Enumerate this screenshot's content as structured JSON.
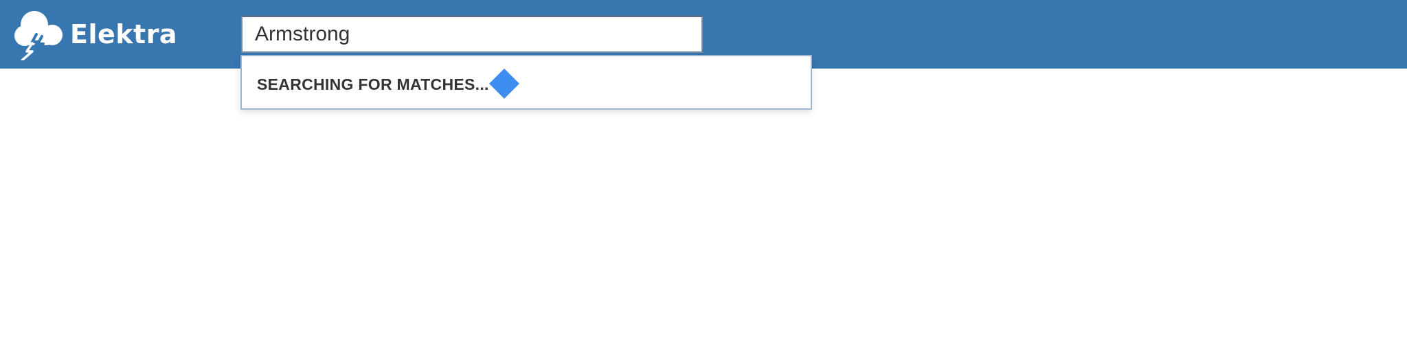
{
  "app": {
    "name": "Elektra",
    "header_color": "#3876b0"
  },
  "search": {
    "value": "Armstrong"
  },
  "autocomplete": {
    "status_text": "SEARCHING FOR MATCHES...",
    "spinner_color": "#3d8ef0"
  },
  "icons": {
    "logo": "cloud-lightning-icon",
    "spinner": "diamond-spinner-icon"
  }
}
